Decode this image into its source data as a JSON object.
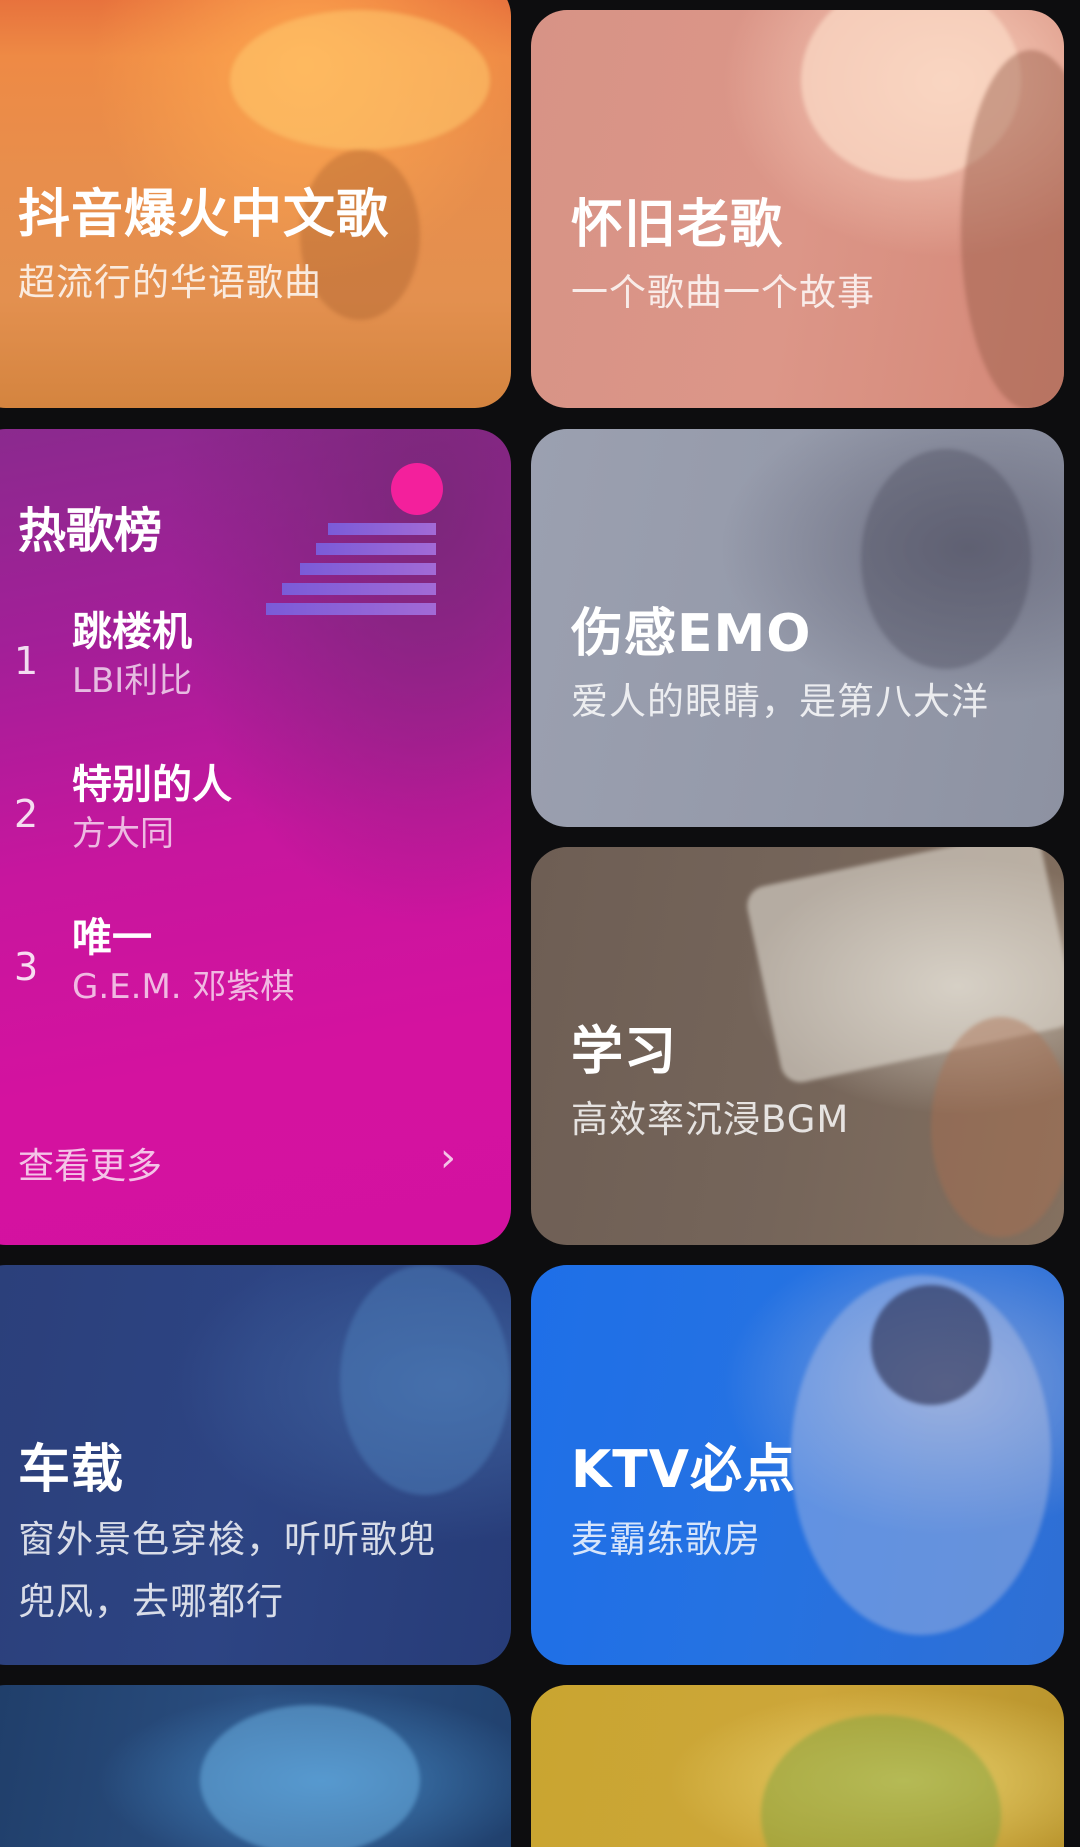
{
  "cards": {
    "douyin": {
      "title": "抖音爆火中文歌",
      "subtitle": "超流行的华语歌曲"
    },
    "nostalgia": {
      "title": "怀旧老歌",
      "subtitle": "一个歌曲一个故事"
    },
    "hot_chart": {
      "title": "热歌榜",
      "items": [
        {
          "rank": "1",
          "song": "跳楼机",
          "artist": "LBI利比"
        },
        {
          "rank": "2",
          "song": "特别的人",
          "artist": "方大同"
        },
        {
          "rank": "3",
          "song": "唯一",
          "artist": "G.E.M. 邓紫棋"
        }
      ],
      "see_more": "查看更多",
      "chevron": "›"
    },
    "emo": {
      "title": "伤感EMO",
      "subtitle": "爱人的眼睛，是第八大洋"
    },
    "study": {
      "title": "学习",
      "subtitle": "高效率沉浸BGM"
    },
    "car": {
      "title": "车载",
      "subtitle_line1": "窗外景色穿梭，听听歌兜",
      "subtitle_line2": "兜风，去哪都行"
    },
    "ktv": {
      "title": "KTV必点",
      "subtitle": "麦霸练歌房"
    }
  },
  "colors": {
    "background": "#0d0d0f",
    "hot_chart_magenta": "#d311a0",
    "ktv_blue": "#1e6fe8"
  }
}
